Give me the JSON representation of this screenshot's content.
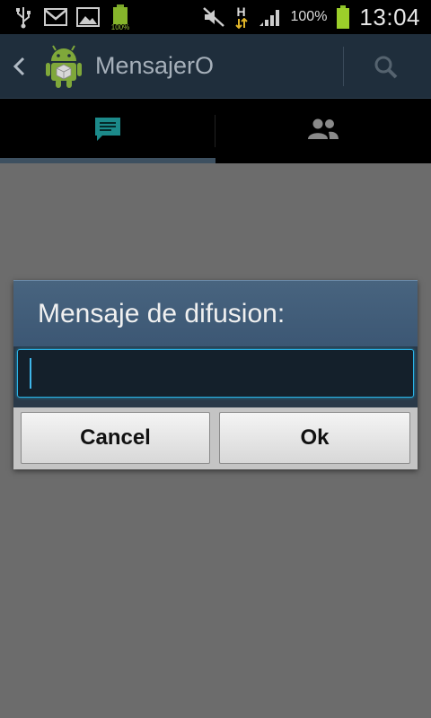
{
  "status_bar": {
    "battery_small_pct": "100%",
    "network_type": "H",
    "battery_pct": "100%",
    "time": "13:04"
  },
  "action_bar": {
    "title": "MensajerO"
  },
  "tabs": [
    {
      "icon": "chat-bubble-icon",
      "selected": true
    },
    {
      "icon": "contacts-icon",
      "selected": false
    }
  ],
  "dialog": {
    "title": "Mensaje de difusion:",
    "input_value": "",
    "cancel_label": "Cancel",
    "ok_label": "Ok"
  },
  "colors": {
    "action_bar": "#1f2e3c",
    "dialog_header": "#48647f",
    "input_focus": "#2ab3e6",
    "selected_tab_icon": "#1c8a8a",
    "dim_background": "#6c6c6c"
  }
}
